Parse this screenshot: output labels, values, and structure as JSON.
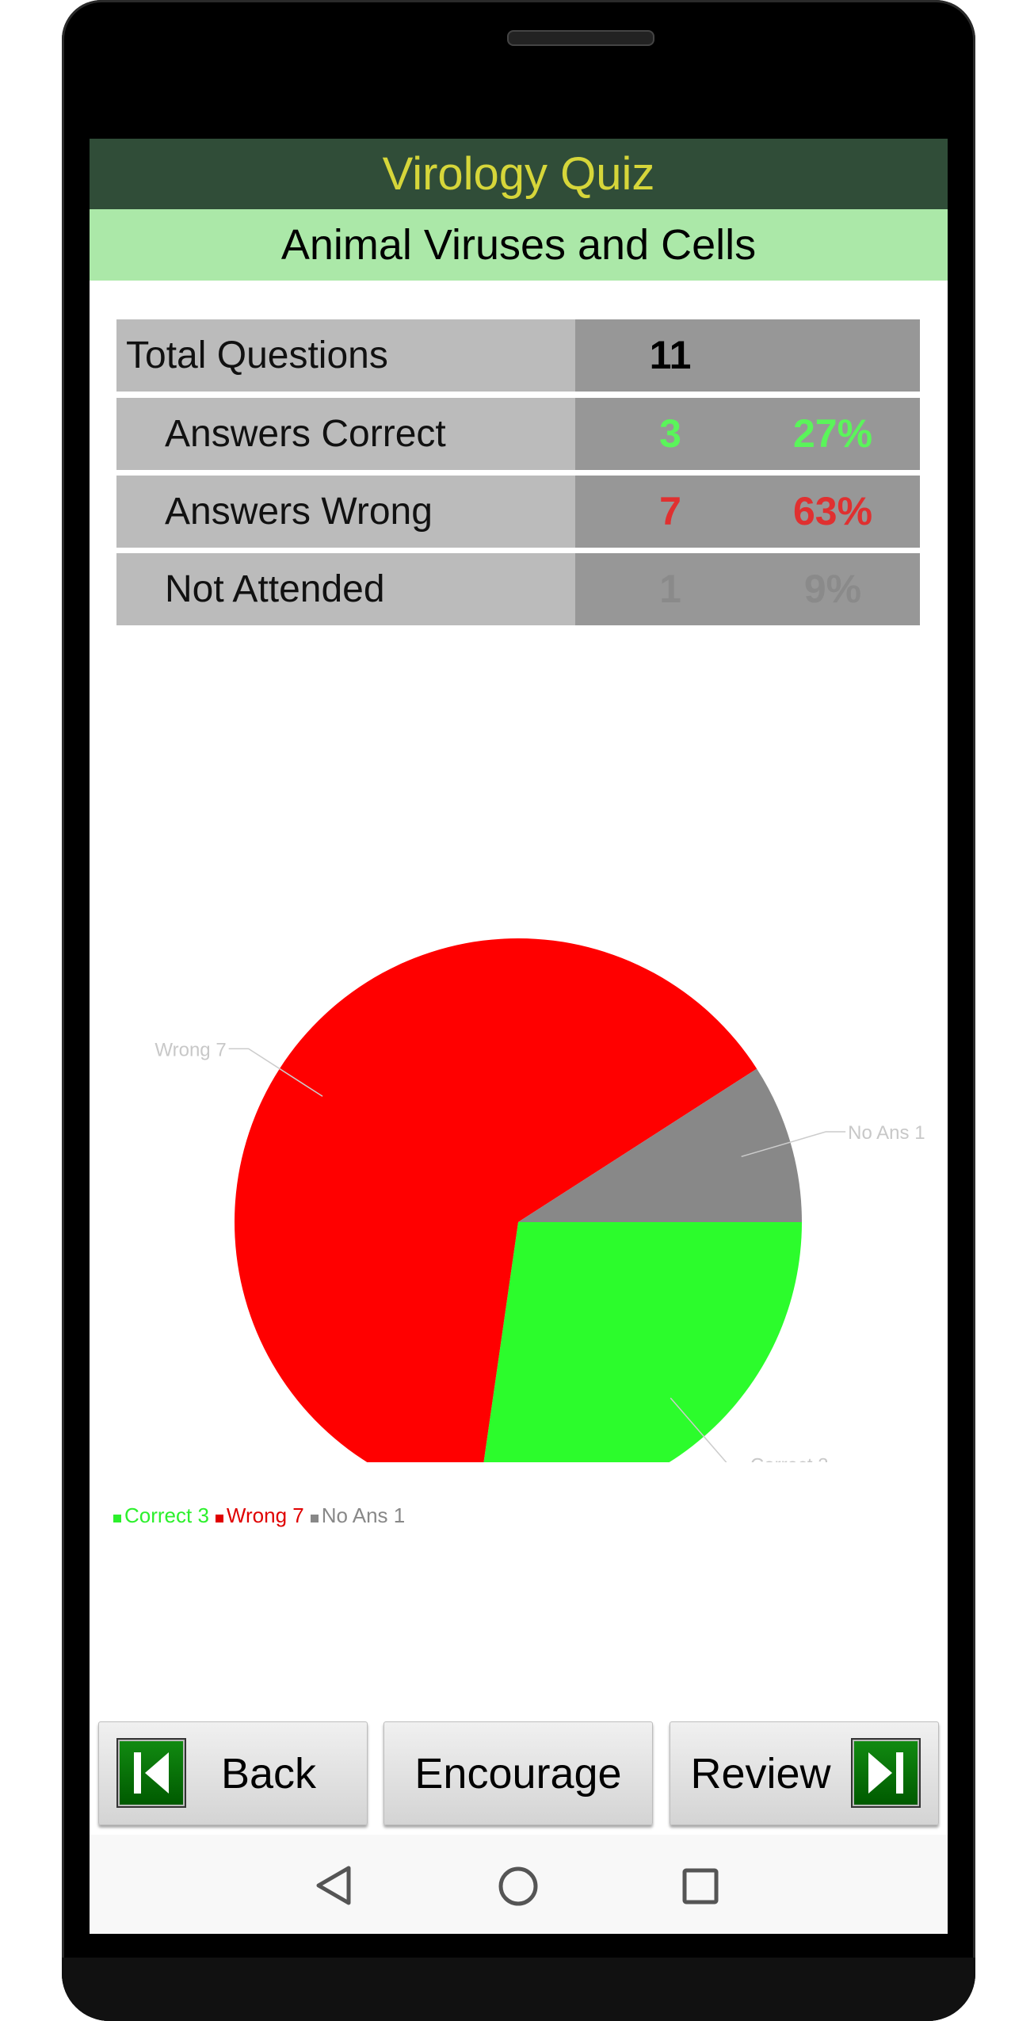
{
  "header": {
    "title": "Virology Quiz",
    "subtitle": "Animal Viruses and Cells"
  },
  "summary": {
    "rows": [
      {
        "label": "Total Questions",
        "count": "11",
        "percent": ""
      },
      {
        "label": "Answers Correct",
        "count": "3",
        "percent": "27%"
      },
      {
        "label": "Answers Wrong",
        "count": "7",
        "percent": "63%"
      },
      {
        "label": "Not Attended",
        "count": "1",
        "percent": "9%"
      }
    ]
  },
  "colors": {
    "correct": "#2cfc2c",
    "wrong": "#ff0000",
    "no_answer": "#888888",
    "correct_text": "#5af55a",
    "wrong_text": "#e03030",
    "no_answer_text": "#8a8a8a"
  },
  "chart_data": {
    "type": "pie",
    "title": "",
    "slices": [
      {
        "label": "Correct 3",
        "name": "Correct",
        "value": 3,
        "color": "#2cfc2c"
      },
      {
        "label": "Wrong 7",
        "name": "Wrong",
        "value": 7,
        "color": "#ff0000"
      },
      {
        "label": "No Ans 1",
        "name": "No Ans",
        "value": 1,
        "color": "#888888"
      }
    ],
    "legend": {
      "placement": "bottom-left",
      "entries": [
        "Correct 3",
        "Wrong 7",
        "No Ans 1"
      ]
    }
  },
  "buttons": {
    "back": "Back",
    "encourage": "Encourage",
    "review": "Review"
  },
  "icons": {
    "back": "skip-back-icon",
    "review": "skip-forward-icon"
  }
}
